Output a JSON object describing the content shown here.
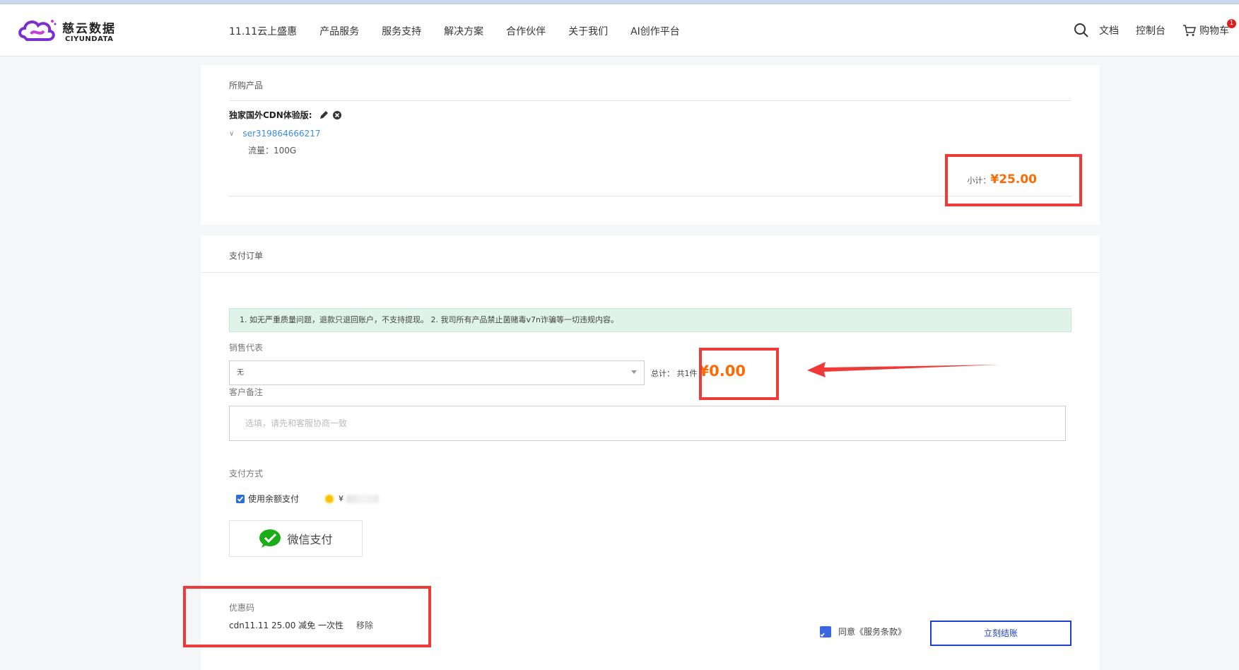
{
  "header": {
    "logo_cn": "慈云数据",
    "logo_en": "CIYUNDATA",
    "nav": [
      "11.11云上盛惠",
      "产品服务",
      "服务支持",
      "解决方案",
      "合作伙伴",
      "关于我们",
      "AI创作平台"
    ],
    "docs": "文档",
    "console": "控制台",
    "cart": "购物车",
    "cart_count": "1"
  },
  "products": {
    "title": "所购产品",
    "product_name": "独家国外CDN体验版:",
    "product_id": "ser319864666217",
    "spec": "流量：100G",
    "subtotal_label": "小计：",
    "subtotal_value": "¥25.00"
  },
  "order": {
    "title": "支付订单",
    "notice": "1. 如无严重质量问题，退款只退回账户，不支持提现。 2. 我司所有产品禁止菌赌毒v7n诈骗等一切违规内容。",
    "sales_label": "销售代表",
    "sales_value": "无",
    "total_label": "总计： 共1件",
    "total_value": "¥0.00",
    "remark_label": "客户备注",
    "remark_placeholder": "选填，请先和客服协商一致",
    "pay_label": "支付方式",
    "balance_label": "使用余额支付",
    "balance_prefix": "¥",
    "wechat_label": "微信支付",
    "coupon_label": "优惠码",
    "coupon_value": "cdn11.11 25.00 减免 一次性",
    "coupon_remove": "移除",
    "agree_label": "同意《服务条款》",
    "pay_button": "立刻结账"
  },
  "colors": {
    "price": "#ff6a00",
    "annotation": "#ef3a3a",
    "link": "#3c8dde",
    "button_border": "#1d3fd0",
    "wechat_green": "#1aad19"
  }
}
